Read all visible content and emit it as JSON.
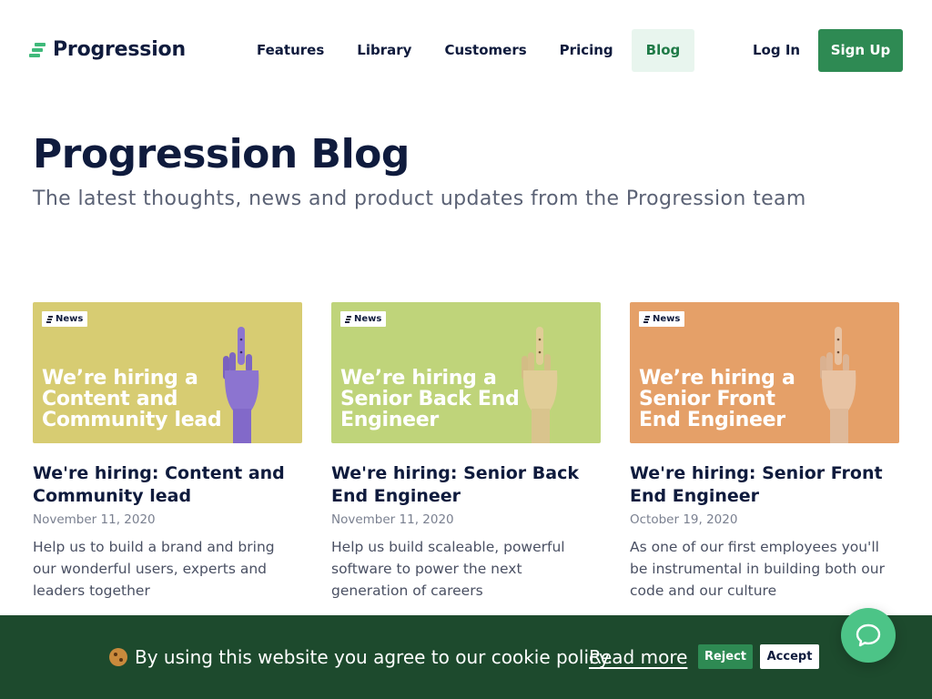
{
  "brand": {
    "name": "Progression",
    "accent": "#2e8a53",
    "logo_green": "#3fb97a"
  },
  "nav": {
    "items": [
      {
        "label": "Features"
      },
      {
        "label": "Library"
      },
      {
        "label": "Customers"
      },
      {
        "label": "Pricing"
      },
      {
        "label": "Blog",
        "active": true
      }
    ],
    "login_label": "Log In",
    "signup_label": "Sign Up"
  },
  "hero": {
    "title": "Progression Blog",
    "subtitle": "The latest thoughts, news and product updates from the Progression team"
  },
  "posts": [
    {
      "badge": "News",
      "image_headline": "We’re hiring a Content and Community lead",
      "image_bg": "#d7cc72",
      "hand_color": "#8c74d0",
      "title": "We're hiring: Content and Community lead",
      "date": "November 11, 2020",
      "excerpt": "Help us to build a brand and bring our wonderful users, experts and leaders together"
    },
    {
      "badge": "News",
      "image_headline": "We’re hiring a Senior Back End Engineer",
      "image_bg": "#bfd47a",
      "hand_color": "#e1cd97",
      "title": "We're hiring: Senior Back End Engineer",
      "date": "November 11, 2020",
      "excerpt": "Help us build scaleable, powerful software to power the next generation of careers"
    },
    {
      "badge": "News",
      "image_headline": "We’re hiring a Senior Front End Engineer",
      "image_bg": "#e5a068",
      "hand_color": "#e8c3a3",
      "title": "We're hiring: Senior Front End Engineer",
      "date": "October 19, 2020",
      "excerpt": "As one of our first employees you'll be instrumental in building both our code and our culture"
    }
  ],
  "cookie": {
    "icon": "cookie-icon",
    "text": "By using this website you agree to our cookie policy.",
    "read_more": "Read more",
    "reject": "Reject",
    "accept": "Accept"
  },
  "chat": {
    "icon": "chat-bubble-icon"
  }
}
